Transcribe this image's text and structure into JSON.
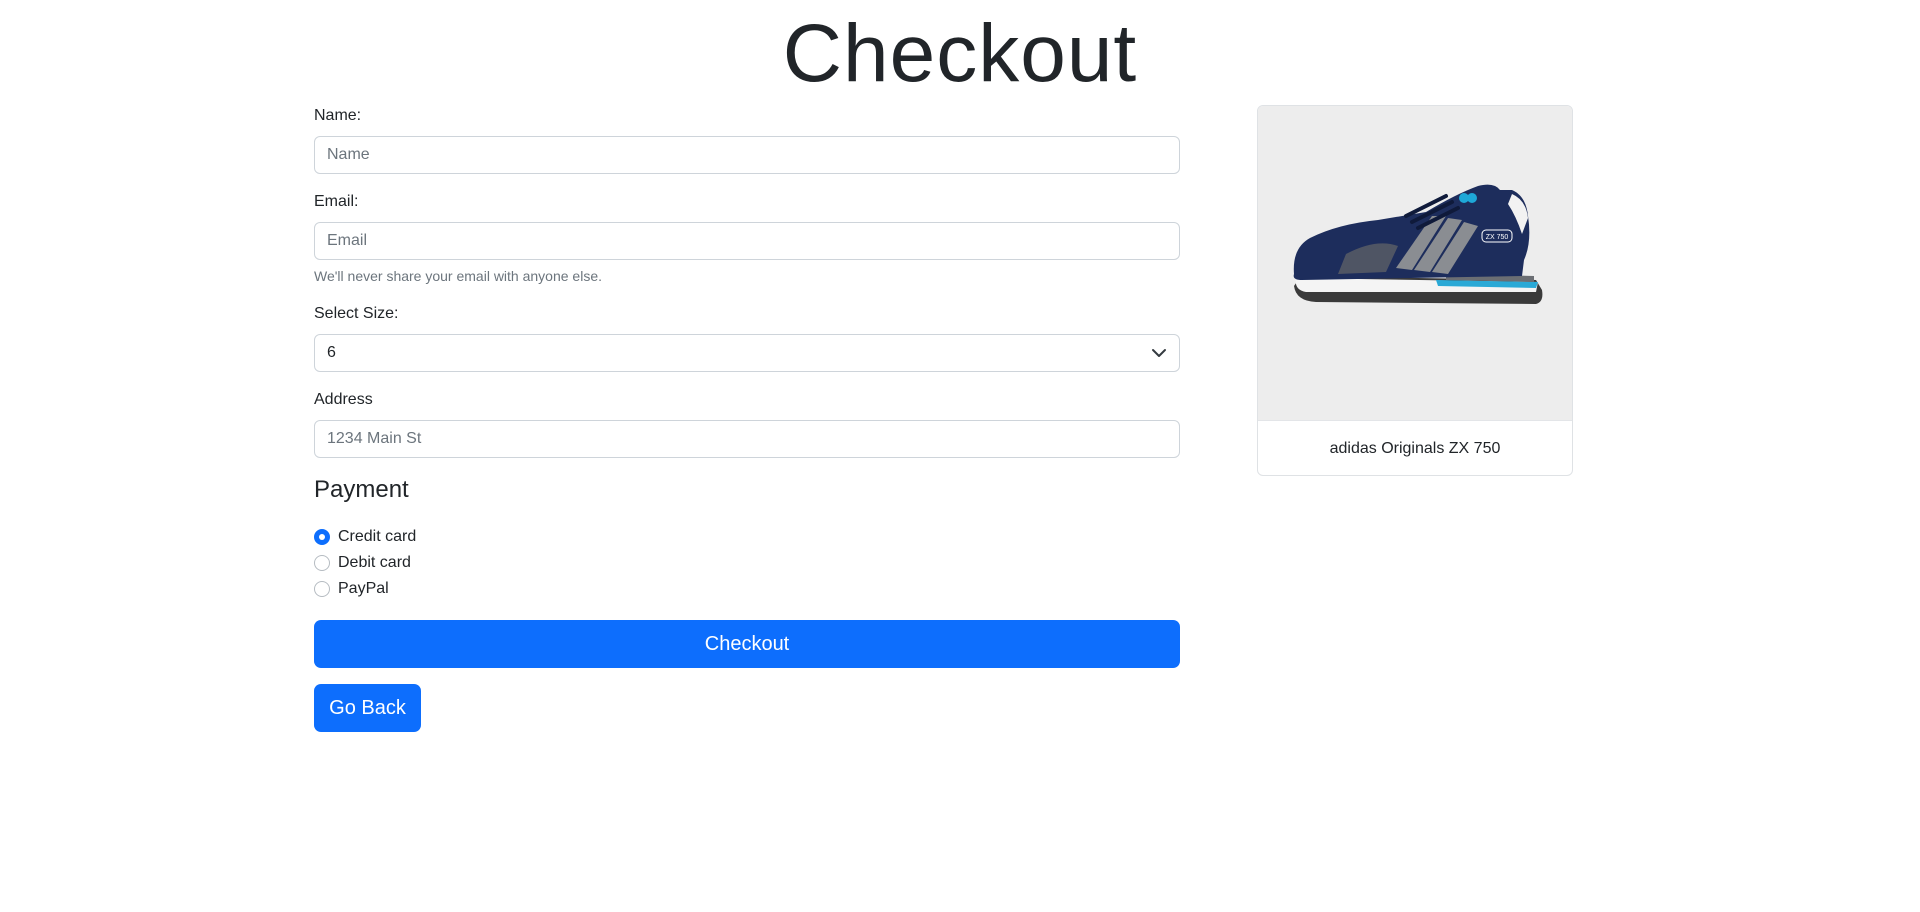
{
  "page": {
    "title": "Checkout"
  },
  "form": {
    "name": {
      "label": "Name:",
      "placeholder": "Name"
    },
    "email": {
      "label": "Email:",
      "placeholder": "Email",
      "help": "We'll never share your email with anyone else."
    },
    "size": {
      "label": "Select Size:",
      "value": "6"
    },
    "address": {
      "label": "Address",
      "placeholder": "1234 Main St"
    },
    "payment": {
      "heading": "Payment",
      "options": [
        {
          "label": "Credit card",
          "checked": true
        },
        {
          "label": "Debit card",
          "checked": false
        },
        {
          "label": "PayPal",
          "checked": false
        }
      ]
    },
    "checkout_label": "Checkout",
    "back_label": "Go Back"
  },
  "product": {
    "name": "adidas Originals ZX 750",
    "badge_text": "ZX 750"
  },
  "colors": {
    "primary": "#0d6efd",
    "shoe_navy": "#1d2d5c",
    "stripe_gray": "#8a8d92",
    "accent_cyan": "#1ea8d8"
  }
}
